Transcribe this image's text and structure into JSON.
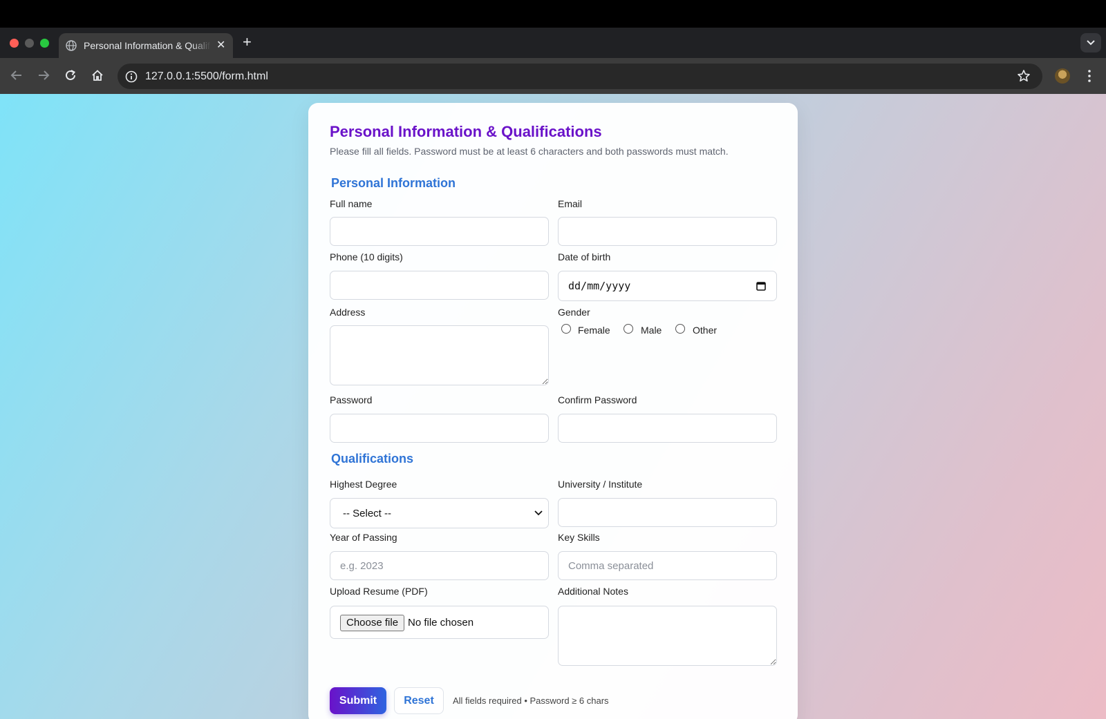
{
  "browser": {
    "tab_title": "Personal Information & Qualifications",
    "url": "127.0.0.1:5500/form.html",
    "icons": {
      "tab": "globe-icon",
      "close": "close-icon",
      "new_tab": "plus-icon",
      "back": "back-arrow-icon",
      "forward": "forward-arrow-icon",
      "reload": "reload-icon",
      "home": "home-icon",
      "site_info": "info-icon",
      "bookmark": "star-icon",
      "menu": "kebab-menu-icon"
    }
  },
  "form": {
    "title": "Personal Information & Qualifications",
    "subtitle": "Please fill all fields. Password must be at least 6 characters and both passwords must match.",
    "personal": {
      "heading": "Personal Information",
      "full_name_label": "Full name",
      "email_label": "Email",
      "phone_label": "Phone (10 digits)",
      "dob_label": "Date of birth",
      "dob_placeholder": "dd/mm/yyyy",
      "address_label": "Address",
      "gender_label": "Gender",
      "gender_options": [
        "Female",
        "Male",
        "Other"
      ],
      "password_label": "Password",
      "confirm_password_label": "Confirm Password"
    },
    "qualifications": {
      "heading": "Qualifications",
      "degree_label": "Highest Degree",
      "degree_selected": "-- Select --",
      "university_label": "University / Institute",
      "year_label": "Year of Passing",
      "year_placeholder": "e.g. 2023",
      "skills_label": "Key Skills",
      "skills_placeholder": "Comma separated",
      "resume_label": "Upload Resume (PDF)",
      "resume_button": "Choose file",
      "resume_status": "No file chosen",
      "notes_label": "Additional Notes"
    },
    "actions": {
      "submit": "Submit",
      "reset": "Reset",
      "hint": "All fields required • Password ≥ 6 chars"
    }
  },
  "colors": {
    "title": "#6a12c9",
    "section": "#2f74d6",
    "submit_gradient_start": "#6a12c9",
    "submit_gradient_end": "#2f63e0"
  }
}
